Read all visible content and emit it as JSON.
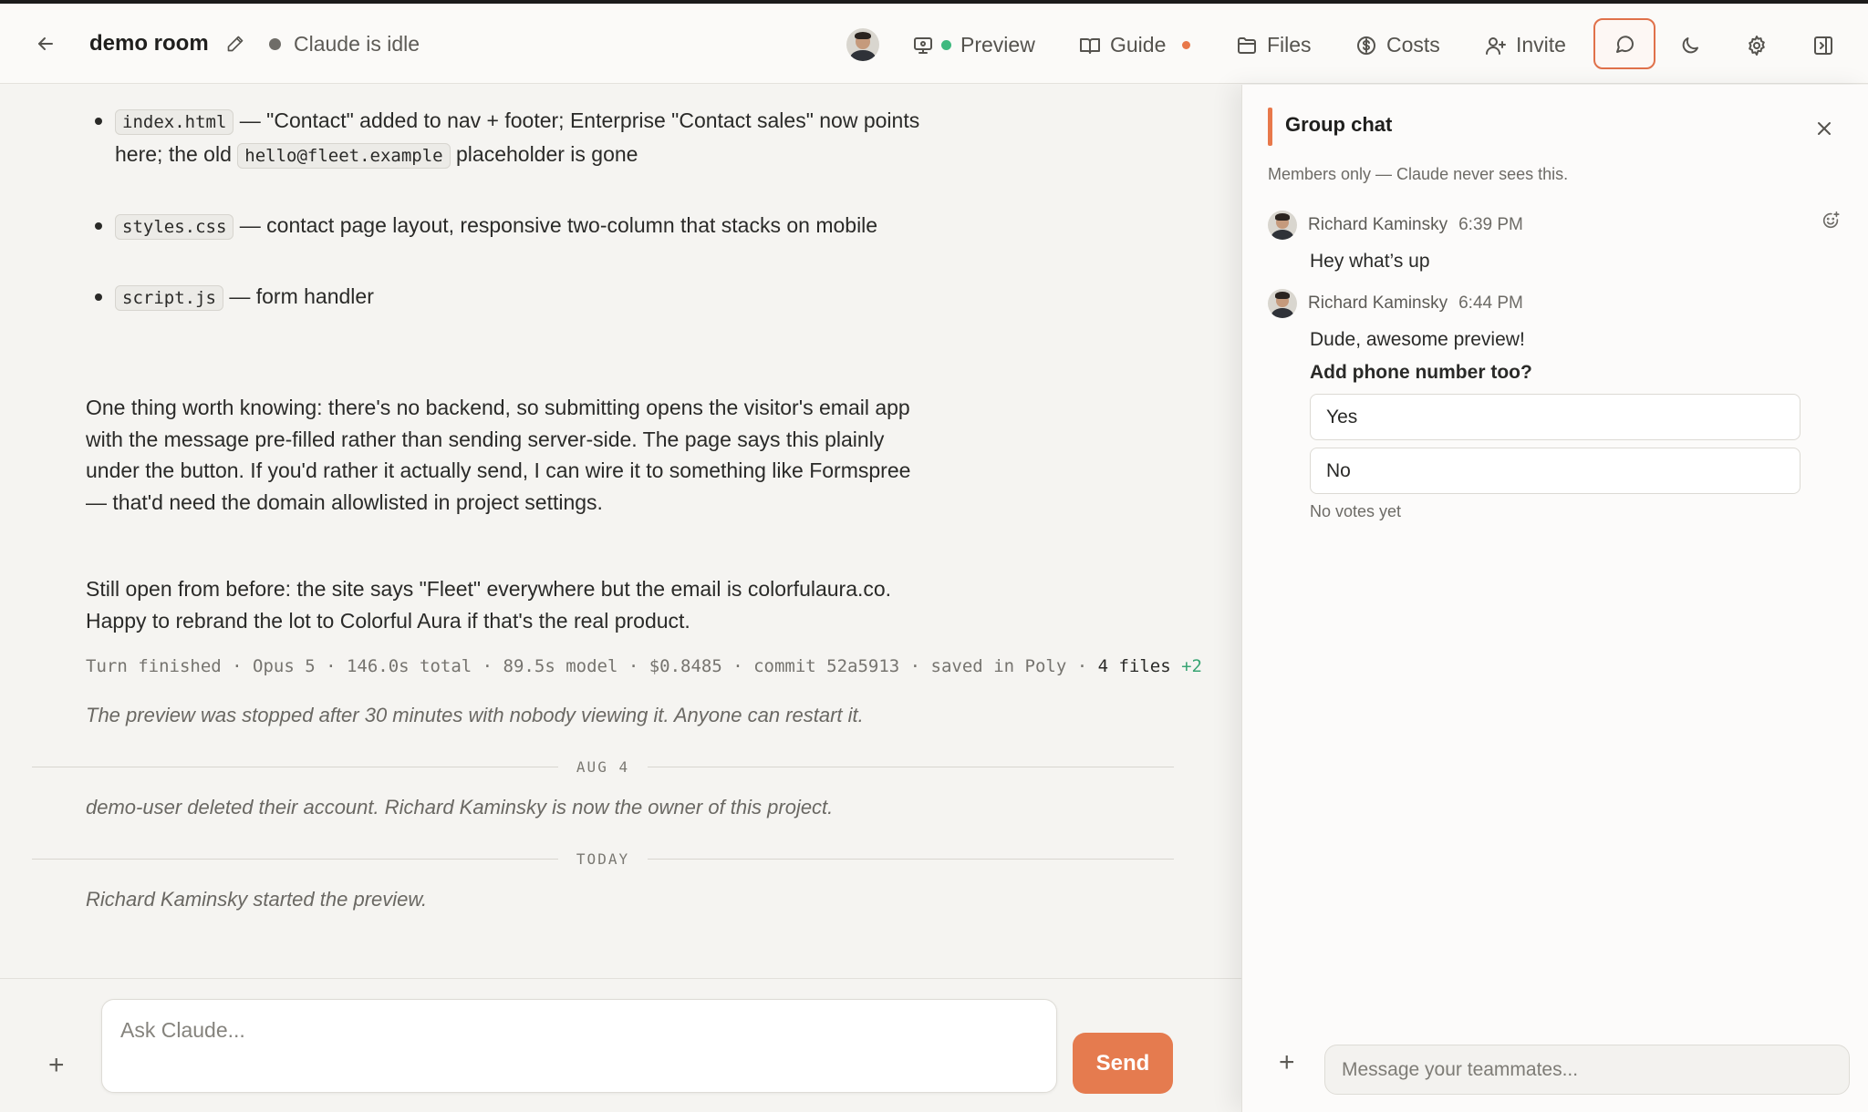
{
  "header": {
    "room_title": "demo room",
    "status": "Claude is idle",
    "nav": {
      "preview": "Preview",
      "guide": "Guide",
      "files": "Files",
      "costs": "Costs",
      "invite": "Invite"
    }
  },
  "main": {
    "bullets": [
      {
        "code": "index.html",
        "text_a": " — \"Contact\" added to nav + footer; Enterprise \"Contact sales\" now points here; the old ",
        "code2": "hello@fleet.example",
        "text_b": " placeholder is gone"
      },
      {
        "code": "styles.css",
        "text_a": " — contact page layout, responsive two-column that stacks on mobile"
      },
      {
        "code": "script.js",
        "text_a": " — form handler"
      }
    ],
    "paragraph1": "One thing worth knowing: there's no backend, so submitting opens the visitor's email app with the message pre-filled rather than sending server-side. The page says this plainly under the button. If you'd rather it actually send, I can wire it to something like Formspree — that'd need the domain allowlisted in project settings.",
    "paragraph2": "Still open from before: the site says \"Fleet\" everywhere but the email is colorfulaura.co. Happy to rebrand the lot to Colorful Aura if that's the real product.",
    "turn_meta": {
      "text": "Turn finished · Opus 5 · 146.0s total · 89.5s model · $0.8485 · commit 52a5913 · saved in Poly · ",
      "files": "4 files",
      "added": " +2"
    },
    "note_stopped": "The preview was stopped after 30 minutes with nobody viewing it. Anyone can restart it.",
    "divider_aug": "AUG 4",
    "note_deleted": "demo-user deleted their account. Richard Kaminsky is now the owner of this project.",
    "divider_today": "TODAY",
    "note_started": "Richard Kaminsky started the preview.",
    "composer": {
      "placeholder": "Ask Claude...",
      "send_label": "Send",
      "plus": "+"
    }
  },
  "chat": {
    "title": "Group chat",
    "subtitle": "Members only — Claude never sees this.",
    "messages": [
      {
        "author": "Richard Kaminsky",
        "time": "6:39 PM",
        "text": "Hey what’s up"
      },
      {
        "author": "Richard Kaminsky",
        "time": "6:44 PM",
        "text": "Dude, awesome preview!"
      }
    ],
    "poll": {
      "question": "Add phone number too?",
      "options": [
        "Yes",
        "No"
      ],
      "status": "No votes yet"
    },
    "input_placeholder": "Message your teammates...",
    "plus": "+"
  },
  "colors": {
    "accent": "#e57b4f",
    "status_green": "#3fb97f",
    "added_green": "#3aa574"
  },
  "icons": [
    "back-arrow-icon",
    "pencil-icon",
    "monitor-icon",
    "book-icon",
    "folder-icon",
    "dollar-icon",
    "user-plus-icon",
    "chat-bubble-icon",
    "moon-icon",
    "gear-icon",
    "sidebar-panel-icon",
    "close-icon",
    "add-reaction-icon"
  ]
}
